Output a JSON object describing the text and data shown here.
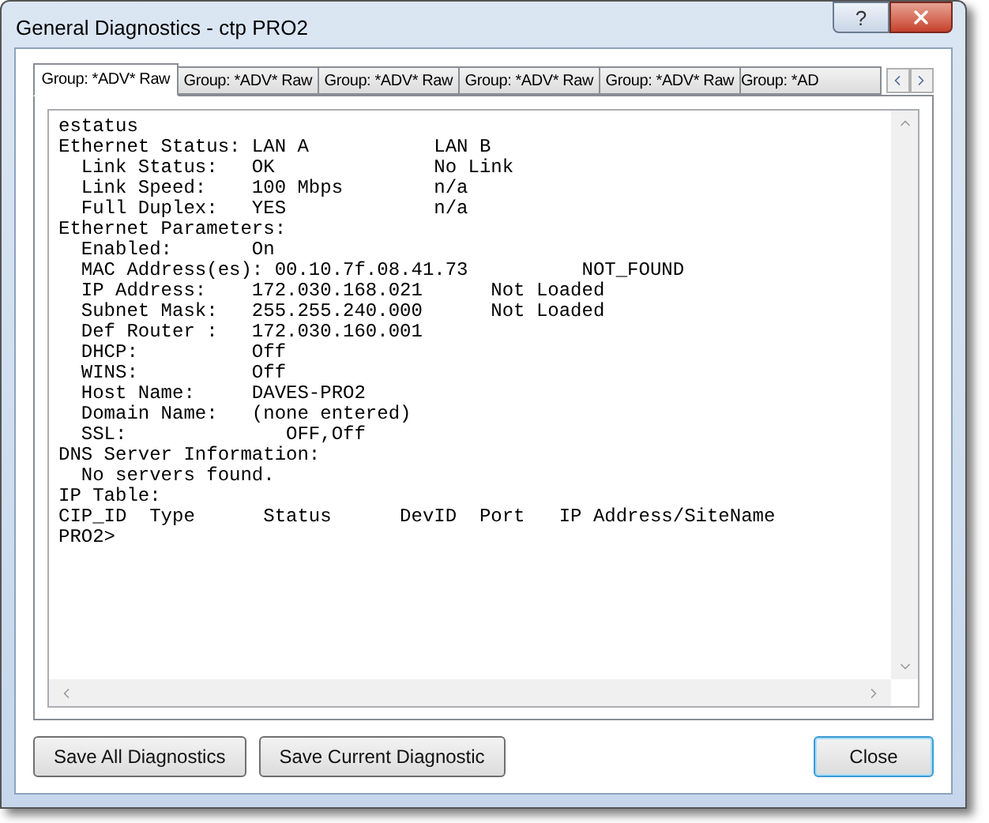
{
  "window": {
    "title": "General Diagnostics - ctp PRO2",
    "help_button": "?"
  },
  "tabs": [
    {
      "label": "Group: *ADV* Raw",
      "selected": true
    },
    {
      "label": "Group: *ADV* Raw",
      "selected": false
    },
    {
      "label": "Group: *ADV* Raw",
      "selected": false
    },
    {
      "label": "Group: *ADV* Raw",
      "selected": false
    },
    {
      "label": "Group: *ADV* Raw",
      "selected": false
    },
    {
      "label": "Group: *AD",
      "selected": false
    }
  ],
  "console": {
    "lines": [
      "estatus",
      "Ethernet Status: LAN A           LAN B",
      "  Link Status:   OK              No Link",
      "  Link Speed:    100 Mbps        n/a",
      "  Full Duplex:   YES             n/a",
      "Ethernet Parameters:",
      "  Enabled:       On",
      "  MAC Address(es): 00.10.7f.08.41.73          NOT_FOUND",
      "  IP Address:    172.030.168.021      Not Loaded",
      "  Subnet Mask:   255.255.240.000      Not Loaded",
      "  Def Router :   172.030.160.001",
      "  DHCP:          Off",
      "  WINS:          Off",
      "  Host Name:     DAVES-PRO2",
      "  Domain Name:   (none entered)",
      "  SSL:              OFF,Off",
      "DNS Server Information:",
      "  No servers found.",
      "IP Table:",
      "CIP_ID  Type      Status      DevID  Port   IP Address/SiteName",
      "PRO2>"
    ]
  },
  "buttons": [
    {
      "label": "Save All Diagnostics",
      "default": false
    },
    {
      "label": "Save Current Diagnostic",
      "default": false
    },
    {
      "label": "Close",
      "default": true
    }
  ]
}
